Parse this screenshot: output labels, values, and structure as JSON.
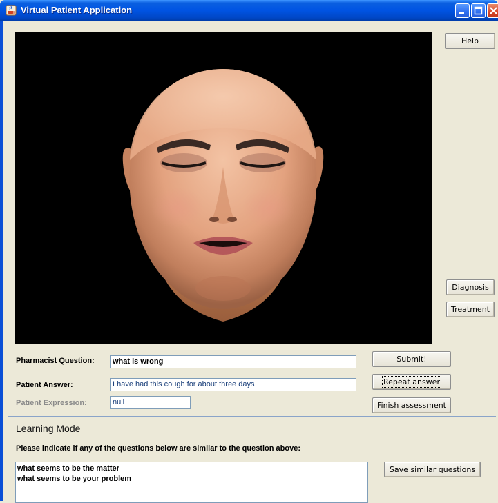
{
  "window": {
    "title": "Virtual Patient Application",
    "icons": [
      "java-cup-icon",
      "minimize-icon",
      "maximize-icon",
      "close-icon"
    ]
  },
  "side_buttons": {
    "help": "Help",
    "diagnosis": "Diagnosis",
    "treatment": "Treatment"
  },
  "form": {
    "question_label": "Pharmacist Question:",
    "question_value": "what is wrong",
    "answer_label": "Patient Answer:",
    "answer_value": "I have had this cough for about three days",
    "expression_label": "Patient Expression:",
    "expression_value": "null",
    "submit": "Submit!",
    "repeat": "Repeat answer",
    "finish": "Finish assessment"
  },
  "learning": {
    "title": "Learning Mode",
    "prompt": "Please indicate if any of the questions below are similar to the question above:",
    "questions": [
      "what seems to be the matter",
      "what seems to be your problem"
    ],
    "save": "Save similar questions"
  },
  "colors": {
    "titlebar": "#0054e3",
    "window_bg": "#ece9d8",
    "viewport_bg": "#000000",
    "field_border": "#7f9db9",
    "answer_text": "#1a3f7a"
  }
}
